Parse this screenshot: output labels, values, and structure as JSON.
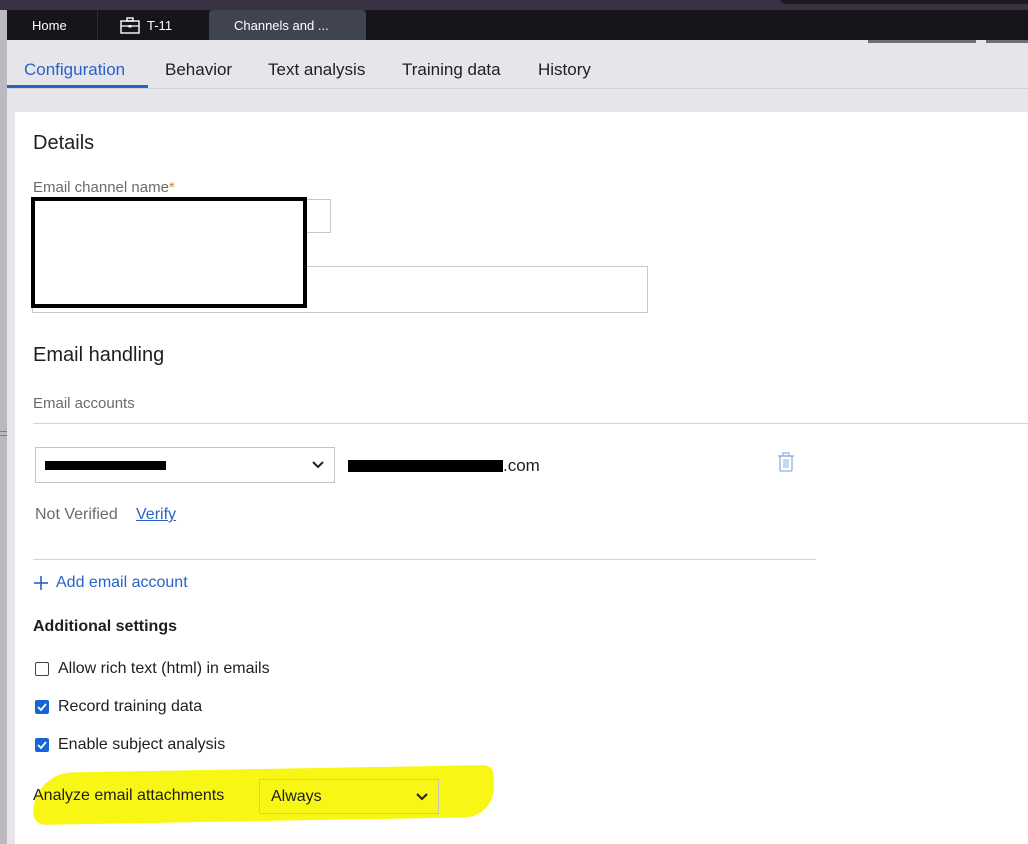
{
  "tabs": {
    "home": "Home",
    "case": "T-11",
    "active": "Channels and ..."
  },
  "subtabs": [
    "Configuration",
    "Behavior",
    "Text analysis",
    "Training data",
    "History"
  ],
  "details": {
    "heading": "Details",
    "channel_name_label": "Email channel name",
    "required_marker": "*"
  },
  "email_handling": {
    "heading": "Email handling",
    "accounts_label": "Email accounts",
    "account_domain": ".com",
    "status": "Not Verified",
    "verify_link": "Verify",
    "add_account": "Add email account"
  },
  "additional": {
    "heading": "Additional settings",
    "options": [
      {
        "label": "Allow rich text (html) in emails",
        "checked": false
      },
      {
        "label": "Record training data",
        "checked": true
      },
      {
        "label": "Enable subject analysis",
        "checked": true
      }
    ],
    "attachments_label": "Analyze email attachments",
    "attachments_value": "Always"
  },
  "colors": {
    "accent": "#2862c8",
    "highlight": "#f8f614",
    "checkbox": "#1466d6"
  }
}
